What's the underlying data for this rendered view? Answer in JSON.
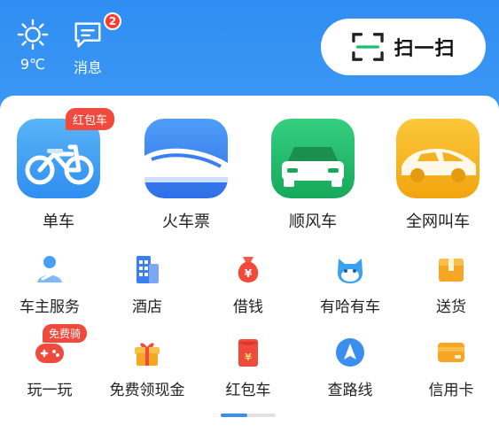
{
  "header": {
    "weather": {
      "icon": "sun-icon",
      "temperature": "9℃"
    },
    "messages": {
      "icon": "chat-icon",
      "label": "消息",
      "badge_count": "2"
    },
    "scan": {
      "icon": "scan-icon",
      "label": "扫一扫"
    }
  },
  "main_services": [
    {
      "label": "单车",
      "icon": "bicycle-icon",
      "badge": "红包车",
      "color": "#3aa0f0"
    },
    {
      "label": "火车票",
      "icon": "train-icon",
      "color": "#3b7df2"
    },
    {
      "label": "顺风车",
      "icon": "car-icon",
      "color": "#21b96a"
    },
    {
      "label": "全网叫车",
      "icon": "taxi-icon",
      "color": "#f4b31d"
    }
  ],
  "row_two": [
    {
      "label": "车主服务",
      "icon": "driver-icon"
    },
    {
      "label": "酒店",
      "icon": "hotel-icon"
    },
    {
      "label": "借钱",
      "icon": "money-bag-icon"
    },
    {
      "label": "有哈有车",
      "icon": "cat-icon"
    },
    {
      "label": "送货",
      "icon": "package-icon"
    }
  ],
  "row_three": [
    {
      "label": "玩一玩",
      "icon": "gamepad-icon",
      "badge": "免费骑"
    },
    {
      "label": "免费领现金",
      "icon": "gift-icon"
    },
    {
      "label": "红包车",
      "icon": "red-envelope-icon"
    },
    {
      "label": "查路线",
      "icon": "route-icon"
    },
    {
      "label": "信用卡",
      "icon": "credit-card-icon"
    }
  ],
  "colors": {
    "header_blue": "#2f8ef2",
    "badge_red": "#f04a3c",
    "pager_active": "#3a8ef0"
  }
}
